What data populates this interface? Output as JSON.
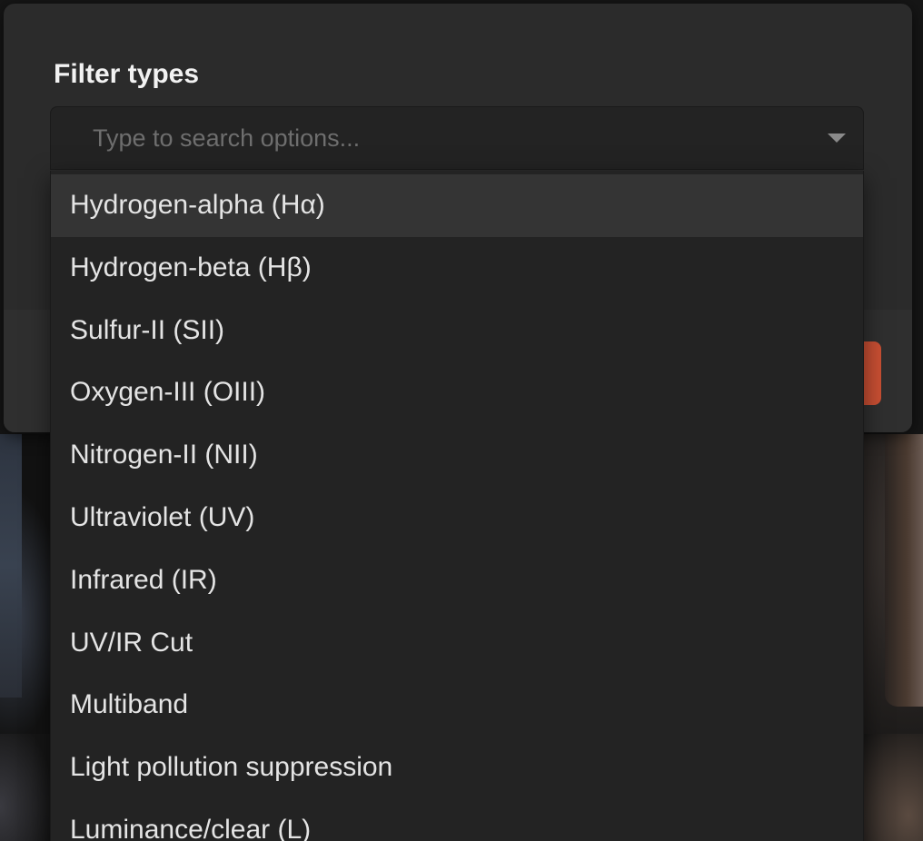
{
  "modal": {
    "title": "Filter types"
  },
  "select": {
    "placeholder": "Type to search options...",
    "value": "",
    "icon": "chevron-down-icon"
  },
  "options": [
    {
      "label": "Hydrogen-alpha (Hα)",
      "highlighted": true
    },
    {
      "label": "Hydrogen-beta (Hβ)",
      "highlighted": false
    },
    {
      "label": "Sulfur-II (SII)",
      "highlighted": false
    },
    {
      "label": "Oxygen-III (OIII)",
      "highlighted": false
    },
    {
      "label": "Nitrogen-II (NII)",
      "highlighted": false
    },
    {
      "label": "Ultraviolet (UV)",
      "highlighted": false
    },
    {
      "label": "Infrared (IR)",
      "highlighted": false
    },
    {
      "label": "UV/IR Cut",
      "highlighted": false
    },
    {
      "label": "Multiband",
      "highlighted": false
    },
    {
      "label": "Light pollution suppression",
      "highlighted": false
    },
    {
      "label": "Luminance/clear (L)",
      "highlighted": false
    }
  ],
  "colors": {
    "modal_background": "#2b2b2b",
    "dropdown_background": "#232323",
    "highlight_background": "#343434",
    "accent": "#c94f33",
    "text": "#e4e4e4",
    "placeholder_text": "#6e6e6e"
  }
}
